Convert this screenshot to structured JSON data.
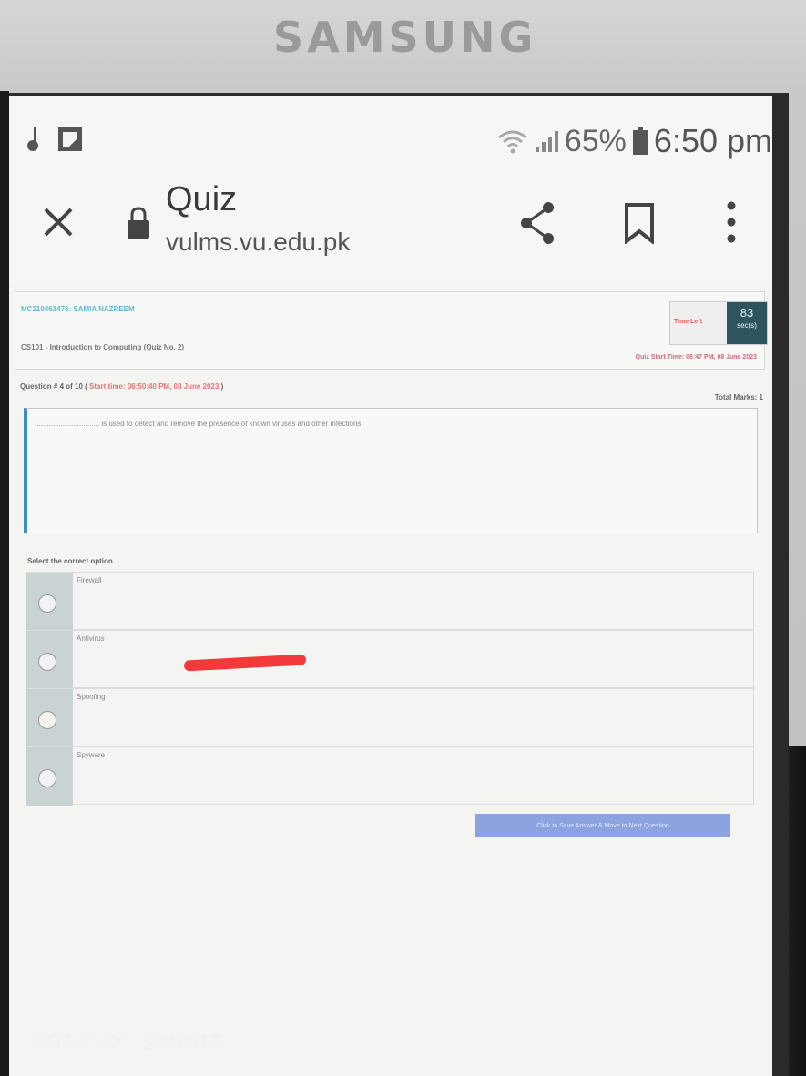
{
  "device": {
    "brand": "SAMSUNG",
    "watermark_brand": "Infinix",
    "watermark_suffix": "SMART"
  },
  "status_bar": {
    "battery_percent": "65%",
    "time": "6:50 pm"
  },
  "browser": {
    "title": "Quiz",
    "url": "vulms.vu.edu.pk",
    "icons": [
      "close-icon",
      "lock-icon",
      "share-icon",
      "bookmark-icon",
      "more-icon"
    ]
  },
  "quiz": {
    "student": "MC210461476: SAMIA NAZREEM",
    "course": "CS101 - Introduction to Computing (Quiz No. 2)",
    "timer_label": "Time Left",
    "timer_value": "83",
    "timer_unit": "sec(s)",
    "quiz_start": "Quiz Start Time: 06:47 PM, 08 June 2023",
    "question_prefix": "Question # 4 of 10 (",
    "question_start": "Start time: 06:50:40 PM, 08 June 2023",
    "question_suffix": ")",
    "total_marks": "Total Marks: 1",
    "question_text": "................................ is used to detect and remove the presence of known viruses and other infections.",
    "select_label": "Select the correct option",
    "options": [
      "Firewall",
      "Antivirus",
      "Spoofing",
      "Spyware"
    ],
    "next_button": "Click to Save Answer & Move to Next Question"
  },
  "colors": {
    "accent_blue": "#3a8fc0",
    "timer_bg": "#2e5460",
    "button_bg": "#8da3e0",
    "annotation_red": "#f23a3a"
  }
}
